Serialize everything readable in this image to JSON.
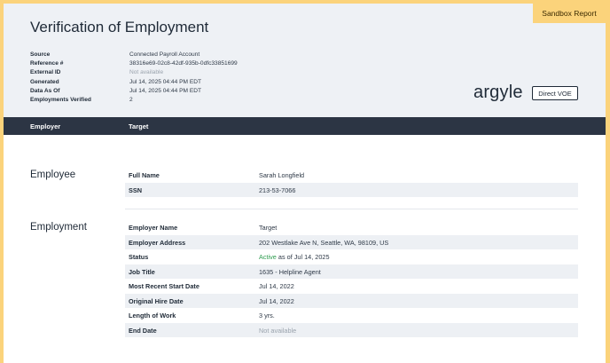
{
  "badge": "Sandbox Report",
  "title": "Verification of Employment",
  "meta": [
    {
      "label": "Source",
      "value": "Connected Payroll Account"
    },
    {
      "label": "Reference #",
      "value": "38316e69-02c8-42df-935b-0dfc33851699"
    },
    {
      "label": "External ID",
      "value": "Not available"
    },
    {
      "label": "Generated",
      "value": "Jul 14, 2025 04:44 PM EDT"
    },
    {
      "label": "Data As Of",
      "value": "Jul 14, 2025 04:44 PM EDT"
    },
    {
      "label": "Employments Verified",
      "value": "2"
    }
  ],
  "logo": "argyle",
  "voe_tag": "Direct VOE",
  "bar": {
    "col1": "Employer",
    "col2": "Target"
  },
  "employee": {
    "section": "Employee",
    "rows": [
      {
        "label": "Full Name",
        "value": "Sarah Longfield"
      },
      {
        "label": "SSN",
        "value": "213-53-7066"
      }
    ]
  },
  "employment": {
    "section": "Employment",
    "employer_name_label": "Employer Name",
    "employer_name": "Target",
    "employer_address_label": "Employer Address",
    "employer_address": "202 Westlake Ave N, Seattle, WA, 98109, US",
    "status_label": "Status",
    "status_active": "Active",
    "status_rest": "as of Jul 14, 2025",
    "job_title_label": "Job Title",
    "job_title": "1635 - Helpline Agent",
    "recent_start_label": "Most Recent Start Date",
    "recent_start": "Jul 14, 2022",
    "hire_date_label": "Original Hire Date",
    "hire_date": "Jul 14, 2022",
    "length_label": "Length of Work",
    "length": "3 yrs.",
    "end_date_label": "End Date",
    "end_date": "Not available"
  }
}
